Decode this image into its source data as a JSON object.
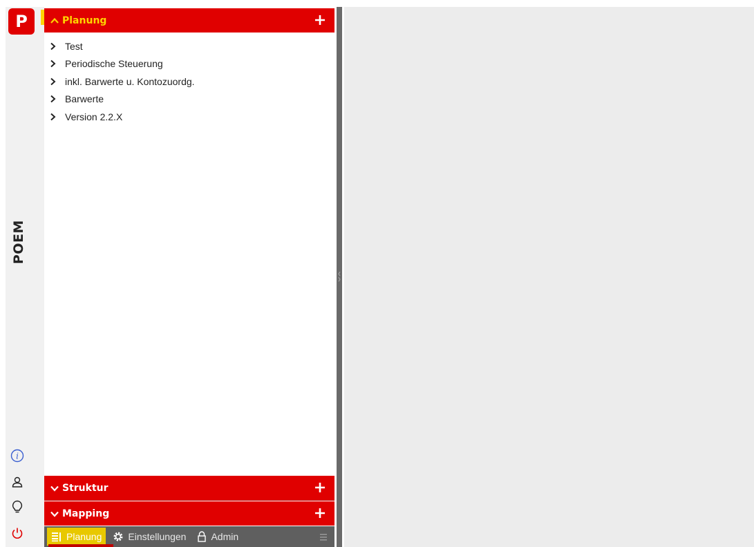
{
  "app": {
    "logo_letter": "P",
    "name": "POEM"
  },
  "sidebar_icons": [
    {
      "name": "info-icon"
    },
    {
      "name": "user-icon"
    },
    {
      "name": "lightbulb-icon"
    },
    {
      "name": "power-icon"
    }
  ],
  "panel": {
    "sections": [
      {
        "title": "Planung",
        "expanded": true
      },
      {
        "title": "Struktur",
        "expanded": false
      },
      {
        "title": "Mapping",
        "expanded": false
      }
    ],
    "tree_items": [
      "Test",
      "Periodische Steuerung",
      "inkl. Barwerte u. Kontozuordg.",
      "Barwerte",
      "Version 2.2.X"
    ]
  },
  "tabs": [
    {
      "label": "Planung",
      "active": true,
      "icon": "list-icon"
    },
    {
      "label": "Einstellungen",
      "active": false,
      "icon": "gear-icon"
    },
    {
      "label": "Admin",
      "active": false,
      "icon": "lock-icon"
    }
  ],
  "colors": {
    "brand_red": "#e00000",
    "accent_yellow": "#ffd400",
    "tabbar_gray": "#5f5f5f",
    "main_bg": "#ececec"
  }
}
